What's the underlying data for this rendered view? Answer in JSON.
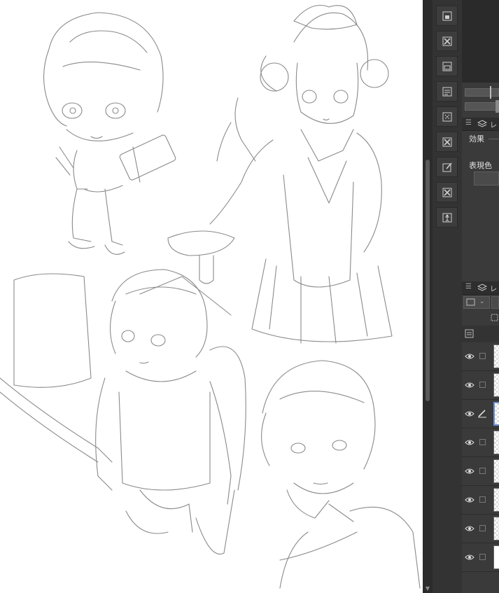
{
  "right_panel": {
    "tab_menu_glyph": "☰",
    "tab_partial_label": "レ",
    "effect_label": "効果",
    "expression_color_label": "表現色",
    "layer_tab_partial_label": "レ"
  },
  "toolstrip": {
    "icons": [
      "layer-from-selection-icon",
      "clear-layer-icon",
      "layer-folder-icon",
      "layer-property-icon",
      "transform-icon",
      "delete-layer-icon",
      "edit-layer-icon",
      "clear-selection-icon",
      "pose-figure-icon"
    ]
  },
  "layers": [
    {
      "visible": true,
      "editing": false,
      "thumb": "transparent"
    },
    {
      "visible": true,
      "editing": false,
      "thumb": "transparent"
    },
    {
      "visible": true,
      "editing": true,
      "thumb": "selected"
    },
    {
      "visible": true,
      "editing": false,
      "thumb": "transparent"
    },
    {
      "visible": true,
      "editing": false,
      "thumb": "transparent"
    },
    {
      "visible": true,
      "editing": false,
      "thumb": "transparent"
    },
    {
      "visible": true,
      "editing": false,
      "thumb": "transparent"
    },
    {
      "visible": true,
      "editing": false,
      "thumb": "white"
    }
  ],
  "colors": {
    "panel_bg": "#3a3a3a",
    "toolstrip_bg": "#333333",
    "selection_accent": "#6b8ed6",
    "line_art": "#8a8a8a"
  }
}
